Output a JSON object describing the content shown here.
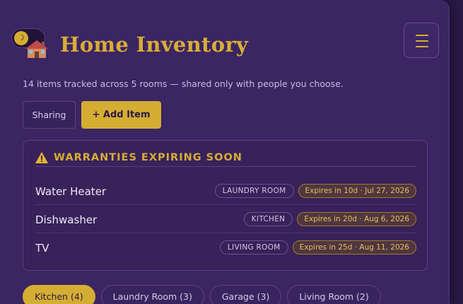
{
  "app": {
    "title": "Home Inventory",
    "subtitle": "14 items tracked across 5 rooms — shared only with people you choose."
  },
  "theme_toggle": {
    "icon": "moon-icon",
    "glyph": "☽"
  },
  "menu": {
    "icon": "hamburger-icon"
  },
  "actions": {
    "sharing_label": "Sharing",
    "add_label": "+ Add Item"
  },
  "warranties": {
    "heading": "WARRANTIES EXPIRING SOON",
    "icon": "warning-icon",
    "items": [
      {
        "name": "Water Heater",
        "room": "LAUNDRY ROOM",
        "expires": "Expires in 10d · Jul 27, 2026"
      },
      {
        "name": "Dishwasher",
        "room": "KITCHEN",
        "expires": "Expires in 20d · Aug 6, 2026"
      },
      {
        "name": "TV",
        "room": "LIVING ROOM",
        "expires": "Expires in 25d · Aug 11, 2026"
      }
    ]
  },
  "room_filters": [
    {
      "label": "Kitchen (4)",
      "active": true
    },
    {
      "label": "Laundry Room (3)",
      "active": false
    },
    {
      "label": "Garage (3)",
      "active": false
    },
    {
      "label": "Living Room (2)",
      "active": false
    }
  ],
  "colors": {
    "accent": "#d4ad33",
    "panel": "#3b2562",
    "background": "#2a1a47"
  }
}
